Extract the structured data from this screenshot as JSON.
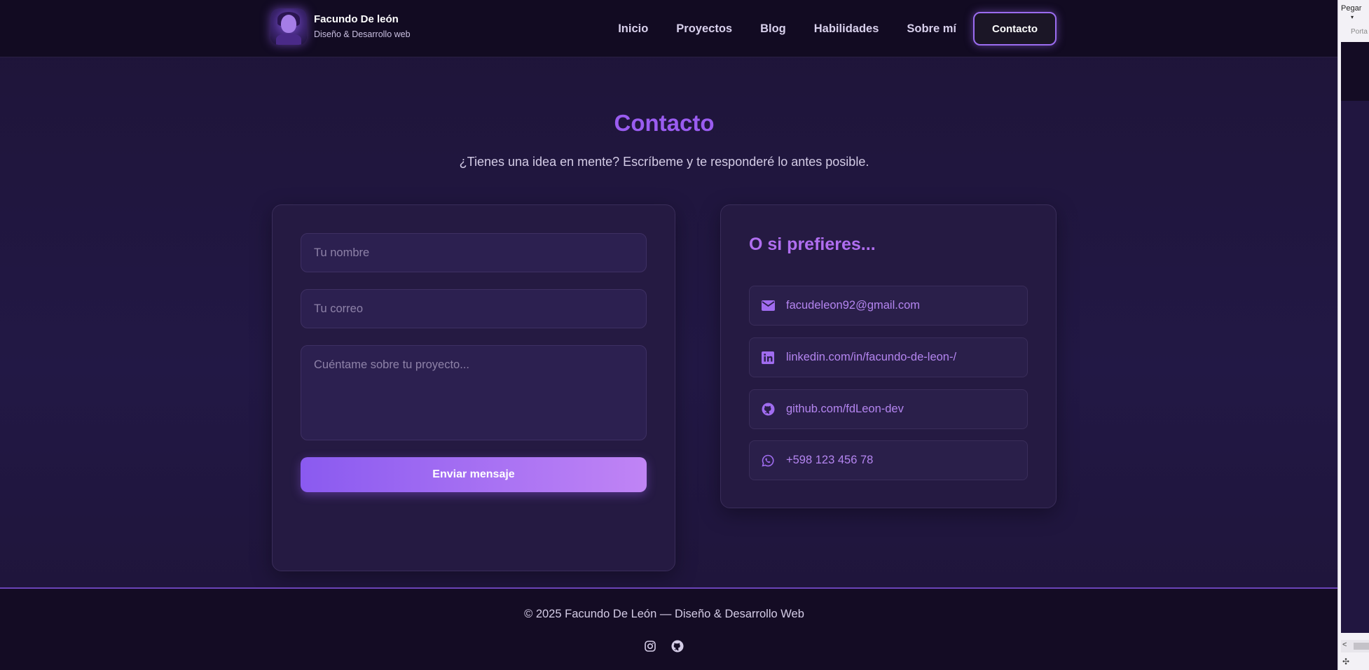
{
  "brand": {
    "name": "Facundo De león",
    "tagline": "Diseño & Desarrollo web"
  },
  "nav": {
    "items": [
      "Inicio",
      "Proyectos",
      "Blog",
      "Habilidades",
      "Sobre mí"
    ],
    "cta": "Contacto"
  },
  "contact": {
    "title": "Contacto",
    "subtitle": "¿Tienes una idea en mente? Escríbeme y te responderé lo antes posible."
  },
  "form": {
    "name_placeholder": "Tu nombre",
    "email_placeholder": "Tu correo",
    "message_placeholder": "Cuéntame sobre tu proyecto...",
    "submit": "Enviar mensaje"
  },
  "info": {
    "title": "O si prefieres...",
    "items": [
      {
        "icon": "envelope-icon",
        "text": "facudeleon92@gmail.com"
      },
      {
        "icon": "linkedin-icon",
        "text": "linkedin.com/in/facundo-de-leon-/"
      },
      {
        "icon": "github-icon",
        "text": "github.com/fdLeon-dev"
      },
      {
        "icon": "whatsapp-icon",
        "text": "+598 123 456 78"
      }
    ]
  },
  "footer": {
    "copyright": "© 2025 Facundo De León — Diseño & Desarrollo Web",
    "social": [
      "instagram-icon",
      "github-icon"
    ]
  },
  "side_panel": {
    "paste_label": "Pegar",
    "porta_label": "Porta"
  },
  "colors": {
    "accent": "#9a5cf0",
    "background": "#1e1438",
    "link": "#b485f0"
  }
}
